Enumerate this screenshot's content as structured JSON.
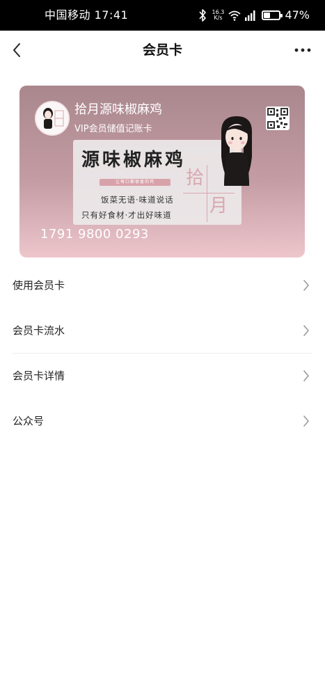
{
  "status_bar": {
    "carrier_time": "中国移动 17:41",
    "net_speed_value": "16.3",
    "net_speed_unit": "K/s",
    "battery_percent": "47%",
    "battery_level": 0.47,
    "icons": [
      "bluetooth-icon",
      "wifi-icon",
      "cellular-signal-icon",
      "battery-icon"
    ]
  },
  "header": {
    "title": "会员卡",
    "back_icon": "chevron-left-icon",
    "more_icon": "more-dots-icon"
  },
  "card": {
    "store_name": "拾月源味椒麻鸡",
    "card_type": "VIP会员储值记账卡",
    "card_number": "1791 9800 0293",
    "qr_icon": "qr-code-icon",
    "logo": {
      "title": "源味椒麻鸡",
      "band_text": "让每口都很香的鸡",
      "slogan_line1": "饭菜无语·味道说话",
      "slogan_line2": "只有好食材·才出好味道",
      "stamp_char1": "拾",
      "stamp_char2": "月"
    },
    "colors": {
      "gradient_top": "#a9878d",
      "gradient_bottom": "#edc6cc"
    }
  },
  "menu": {
    "items": [
      {
        "label": "使用会员卡"
      },
      {
        "label": "会员卡流水"
      },
      {
        "label": "会员卡详情"
      },
      {
        "label": "公众号"
      }
    ]
  }
}
